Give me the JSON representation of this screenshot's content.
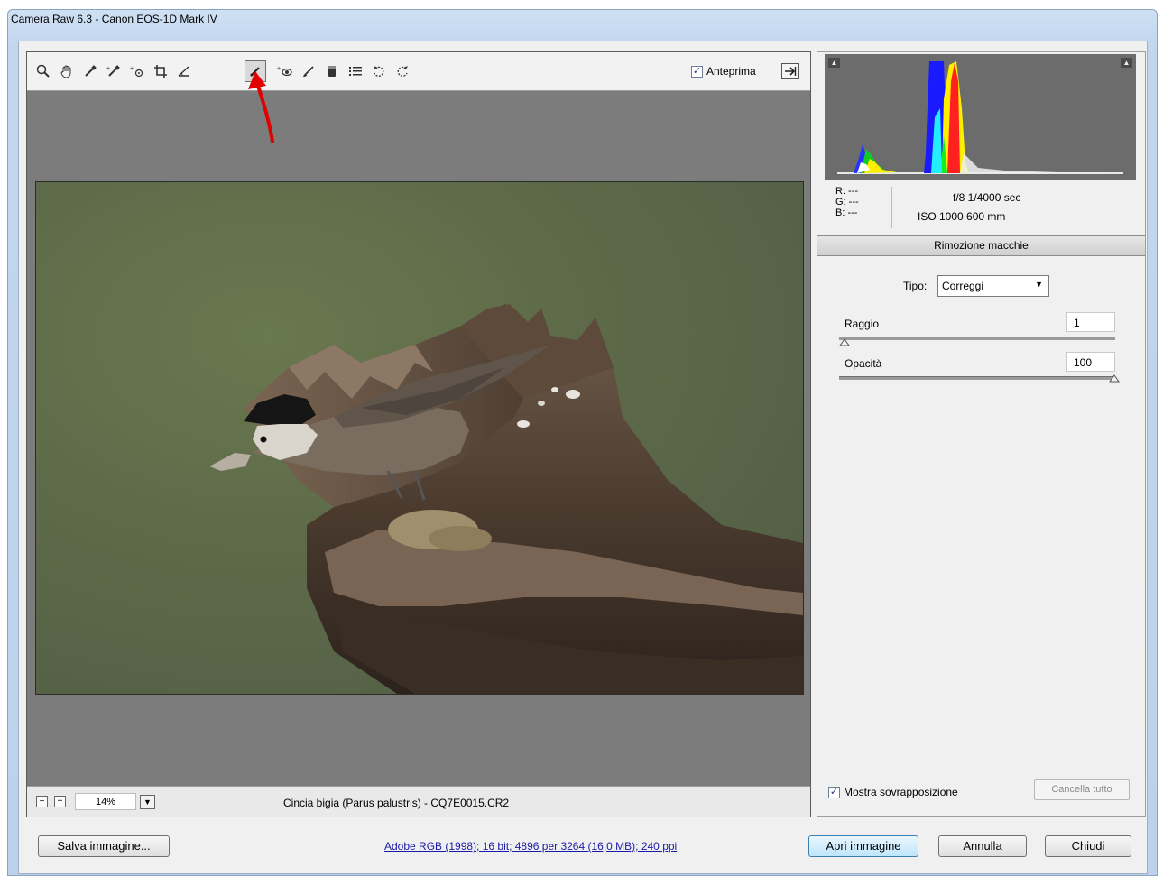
{
  "window": {
    "title": "Camera Raw 6.3  -  Canon EOS-1D Mark IV"
  },
  "toolbar": {
    "tools": [
      {
        "name": "zoom-tool-icon",
        "glyph": "🔍"
      },
      {
        "name": "hand-tool-icon",
        "glyph": "✋"
      },
      {
        "name": "white-balance-tool-icon",
        "glyph": "⁄"
      },
      {
        "name": "color-sampler-tool-icon",
        "glyph": "⁄"
      },
      {
        "name": "targeted-adjustment-tool-icon",
        "glyph": "⊙"
      },
      {
        "name": "crop-tool-icon",
        "glyph": "⌗"
      },
      {
        "name": "straighten-tool-icon",
        "glyph": "△"
      },
      {
        "name": "spot-removal-tool-icon",
        "glyph": "⁄"
      },
      {
        "name": "red-eye-removal-tool-icon",
        "glyph": "◉"
      },
      {
        "name": "adjustment-brush-tool-icon",
        "glyph": "⁄"
      },
      {
        "name": "graduated-filter-tool-icon",
        "glyph": "▮"
      },
      {
        "name": "preferences-icon",
        "glyph": "☰"
      },
      {
        "name": "rotate-ccw-icon",
        "glyph": "↺"
      },
      {
        "name": "rotate-cw-icon",
        "glyph": "↻"
      }
    ],
    "preview_label": "Anteprima",
    "preview_checked": true
  },
  "status": {
    "zoom_value": "14%",
    "file_name": "Cincia bigia (Parus palustris) - CQ7E0015.CR2"
  },
  "readout": {
    "r": "R:  ---",
    "g": "G:  ---",
    "b": "B:  ---",
    "exif_line1": "f/8   1/4000 sec",
    "exif_line2": "ISO 1000   600 mm"
  },
  "panel": {
    "title": "Rimozione macchie",
    "type_label": "Tipo:",
    "type_value": "Correggi",
    "radius_label": "Raggio",
    "radius_value": "1",
    "opacity_label": "Opacità",
    "opacity_value": "100",
    "overlay_label": "Mostra sovrapposizione",
    "overlay_checked": true,
    "clear_all_label": "Cancella tutto"
  },
  "footer": {
    "save_label": "Salva immagine...",
    "workflow_info": "Adobe RGB (1998); 16 bit; 4896 per 3264 (16,0 MB); 240 ppi",
    "open_label": "Apri immagine",
    "cancel_label": "Annulla",
    "done_label": "Chiudi"
  }
}
